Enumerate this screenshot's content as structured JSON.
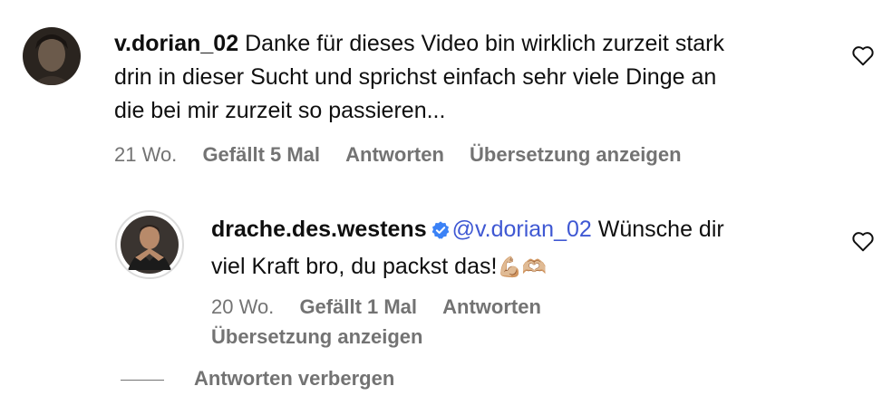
{
  "comment": {
    "username": "v.dorian_02",
    "text_line1": "Danke für dieses Video bin wirklich zurzeit stark",
    "text_line2": "drin in dieser Sucht und sprichst einfach sehr viele Dinge an",
    "text_line3": "die bei mir zurzeit so passieren...",
    "time": "21 Wo.",
    "likes": "Gefällt 5 Mal",
    "reply_label": "Antworten",
    "translate_label": "Übersetzung anzeigen"
  },
  "reply": {
    "username": "drache.des.westens",
    "verified": true,
    "mention": "@v.dorian_02",
    "text_part1": " Wünsche dir",
    "text_line2": "viel Kraft bro, du packst das!",
    "emojis": "💪🏼🫶🏼",
    "time": "20 Wo.",
    "likes": "Gefällt 1 Mal",
    "reply_label": "Antworten",
    "translate_label": "Übersetzung anzeigen"
  },
  "replies_toggle": {
    "label": "Antworten verbergen"
  },
  "colors": {
    "text": "#0f0f0f",
    "meta": "#737373",
    "mention": "#3f58d3",
    "verified": "#3b82f6"
  }
}
